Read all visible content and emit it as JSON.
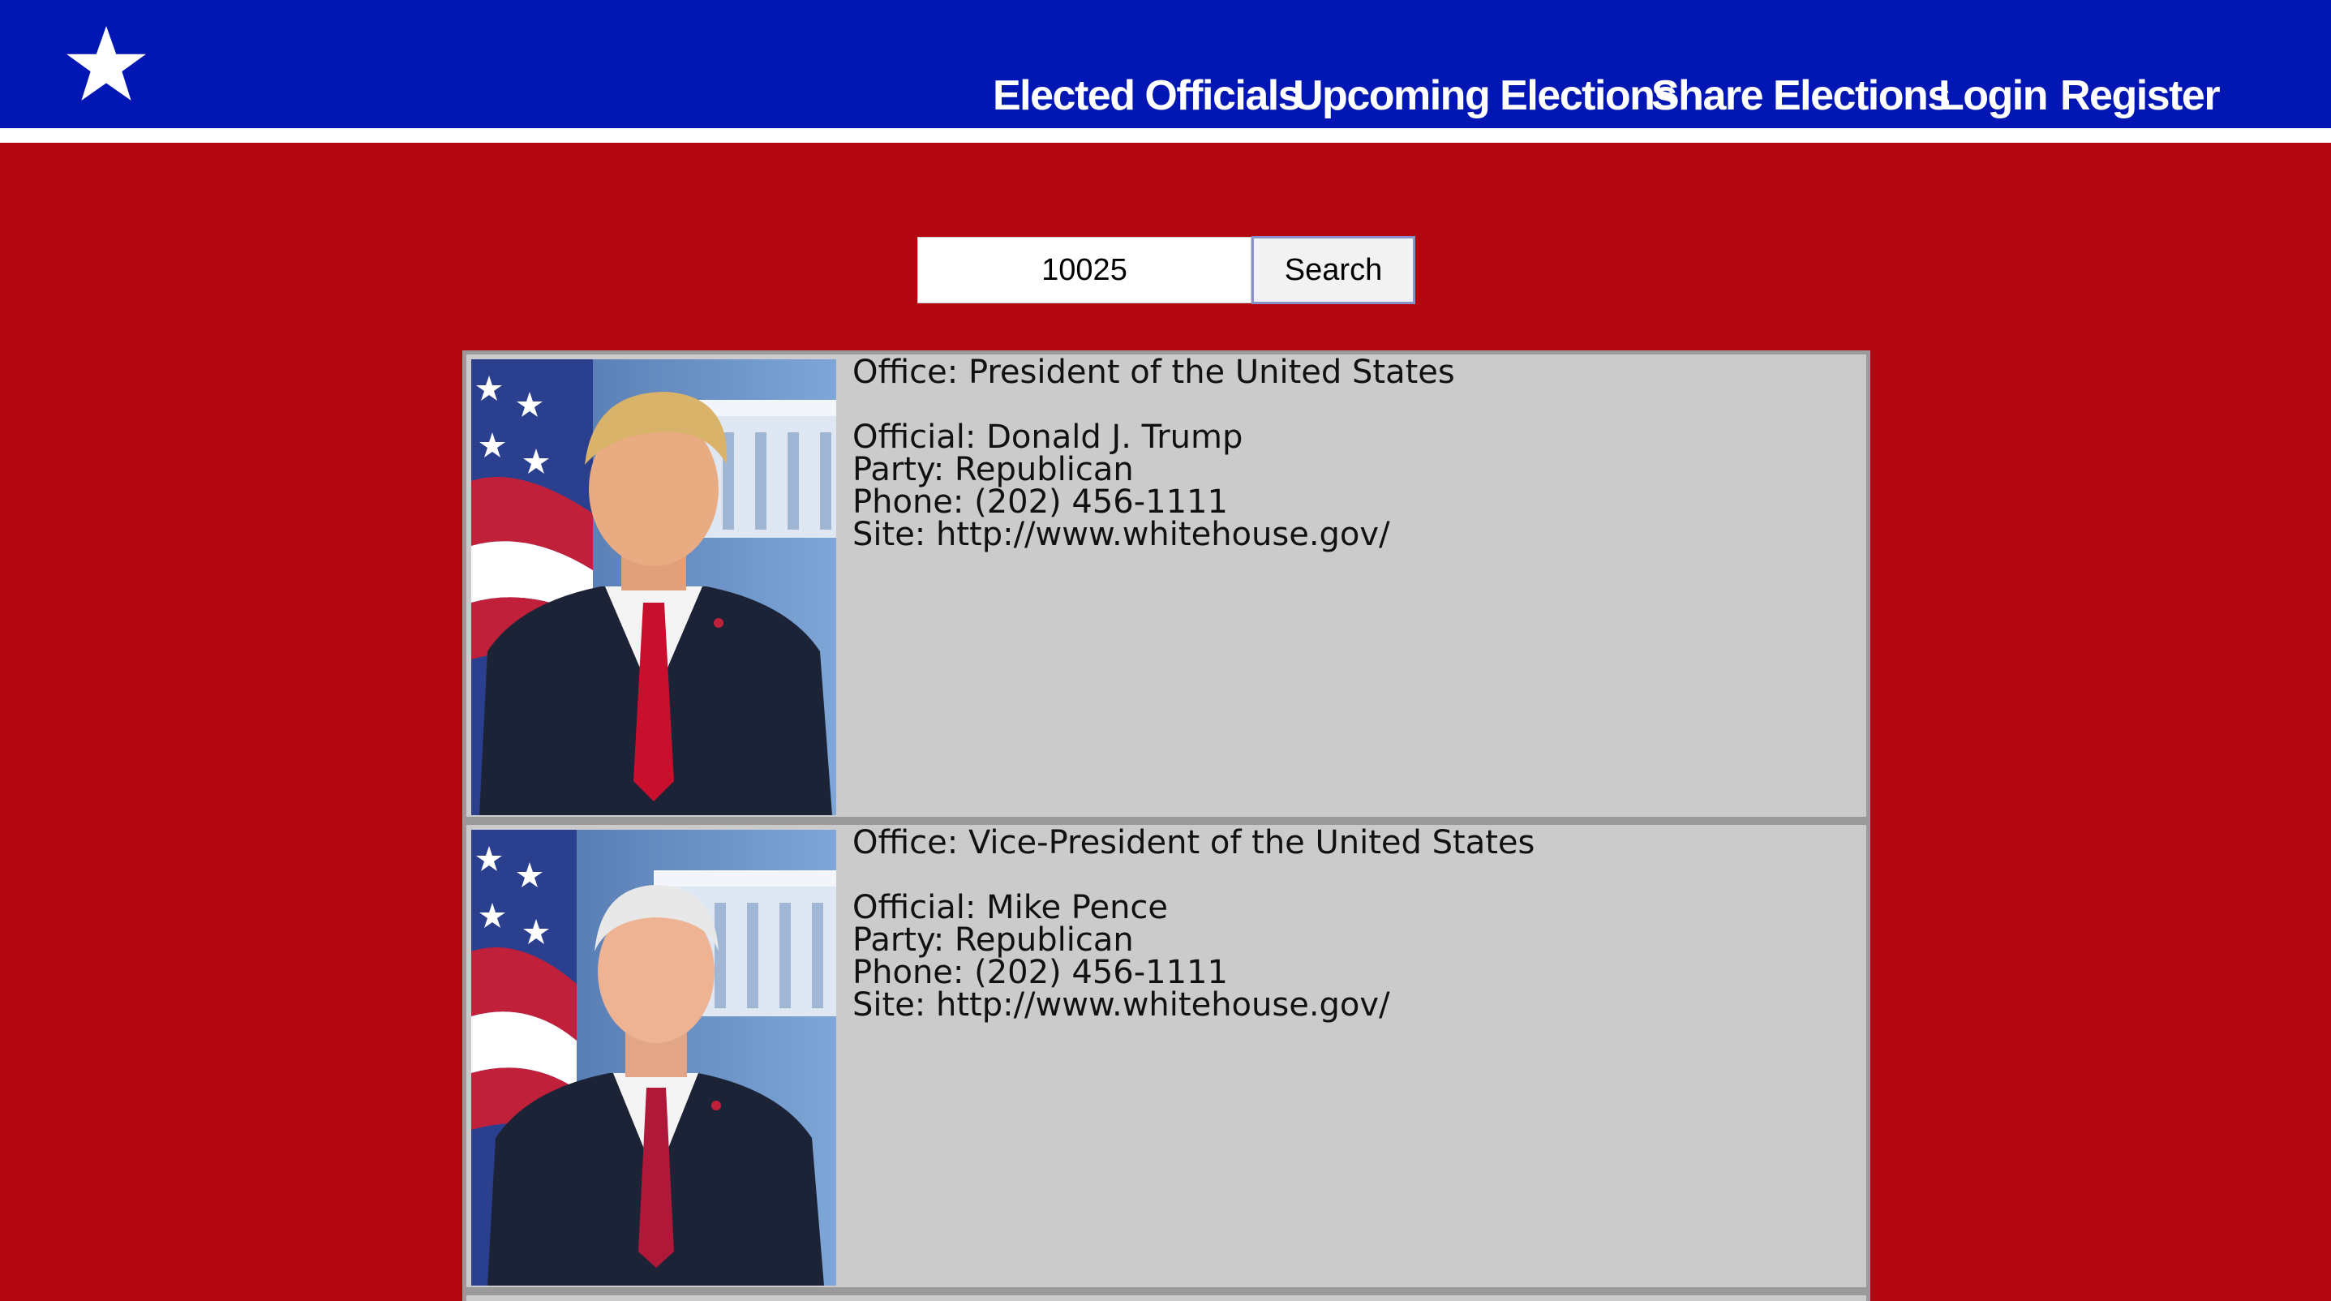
{
  "header": {
    "logo_icon": "star-icon",
    "nav": [
      {
        "label": "Elected Officials"
      },
      {
        "label": "Upcoming Elections"
      },
      {
        "label": "Share Elections"
      },
      {
        "label": "Login"
      },
      {
        "label": "Register"
      }
    ]
  },
  "search": {
    "value": "10025",
    "button_label": "Search"
  },
  "officials": [
    {
      "office": "Office: President of the United States",
      "official": "Official: Donald J. Trump",
      "party": "Party: Republican",
      "phone": "Phone: (202) 456-1111",
      "site": "Site: http://www.whitehouse.gov/",
      "tie_color": "#c8102e",
      "hair_color": "#d9b36a"
    },
    {
      "office": "Office: Vice-President of the United States",
      "official": "Official: Mike Pence",
      "party": "Party: Republican",
      "phone": "Phone: (202) 456-1111",
      "site": "Site: http://www.whitehouse.gov/",
      "tie_color": "#b0183a",
      "hair_color": "#e8e8e8"
    }
  ],
  "colors": {
    "nav_bg": "#0216b3",
    "page_bg": "#b40610",
    "card_bg": "#cbcbcb"
  }
}
